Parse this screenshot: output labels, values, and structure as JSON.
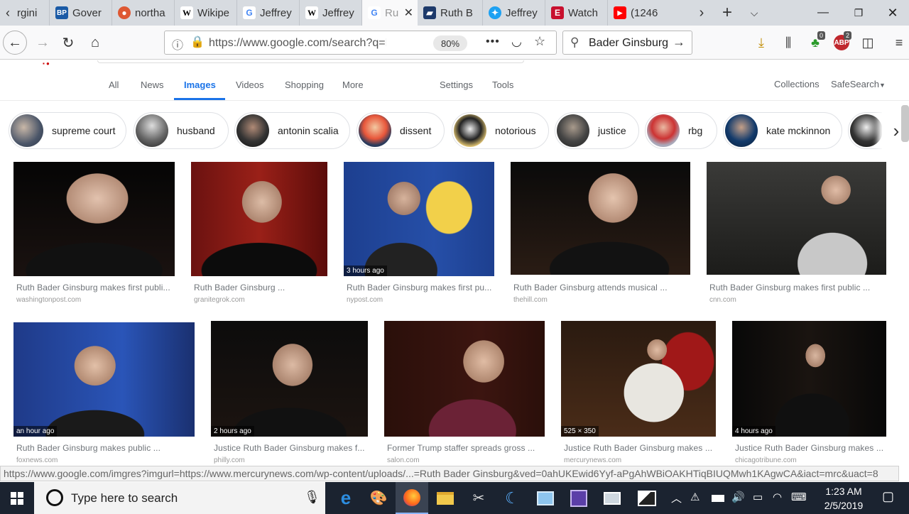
{
  "browser": {
    "tabs": [
      {
        "title": "rgini",
        "icon": "browser-back-icon"
      },
      {
        "title": "Gover",
        "icon": "bp-icon",
        "favicon_text": "BP",
        "color": "#1a5aa6"
      },
      {
        "title": "northa",
        "icon": "duckduckgo-icon",
        "color": "#de5833"
      },
      {
        "title": "Wikipe",
        "icon": "wikipedia-icon",
        "favicon_text": "W"
      },
      {
        "title": "Jeffrey",
        "icon": "google-icon",
        "favicon_text": "G"
      },
      {
        "title": "Jeffrey",
        "icon": "wikipedia-icon",
        "favicon_text": "W"
      },
      {
        "title": "Ru",
        "icon": "google-icon",
        "favicon_text": "G",
        "active": true
      },
      {
        "title": "Ruth B",
        "icon": "news-icon"
      },
      {
        "title": "Jeffrey",
        "icon": "twitter-icon"
      },
      {
        "title": "Watch",
        "icon": "flag-icon",
        "favicon_text": "E"
      },
      {
        "title": "(1246",
        "icon": "youtube-icon"
      }
    ],
    "url": "https://www.google.com/search?q=Ru",
    "zoom": "80%",
    "search_query": "Bader Ginsburg",
    "toolbar_badges": {
      "green": "0",
      "abp": "2"
    },
    "status_url": "https://www.google.com/imgres?imgurl=https://www.mercurynews.com/wp-content/uploads/...=Ruth Bader Ginsburg&ved=0ahUKEwid6Yyf-aPgAhWBiOAKHTiqBIUQMwh1KAgwCA&iact=mrc&uact=8"
  },
  "google": {
    "nav": [
      "All",
      "News",
      "Images",
      "Videos",
      "Shopping",
      "More"
    ],
    "active_nav": "Images",
    "tools": [
      "Settings",
      "Tools"
    ],
    "right": [
      "Collections",
      "SafeSearch"
    ],
    "chips": [
      "supreme court",
      "husband",
      "antonin scalia",
      "dissent",
      "notorious",
      "justice",
      "rbg",
      "kate mckinnon"
    ]
  },
  "results": [
    {
      "title": "Ruth Bader Ginsburg makes first publi...",
      "source": "washingtonpost.com",
      "tag": ""
    },
    {
      "title": "Ruth Bader Ginsburg ...",
      "source": "granitegrok.com",
      "tag": ""
    },
    {
      "title": "Ruth Bader Ginsburg makes first pu...",
      "source": "nypost.com",
      "tag": "3 hours ago"
    },
    {
      "title": "Ruth Bader Ginsburg attends musical ...",
      "source": "thehill.com",
      "tag": ""
    },
    {
      "title": "Ruth Bader Ginsburg makes first public ...",
      "source": "cnn.com",
      "tag": ""
    },
    {
      "title": "Ruth Bader Ginsburg makes public ...",
      "source": "foxnews.com",
      "tag": "an hour ago"
    },
    {
      "title": "Justice Ruth Bader Ginsburg makes f...",
      "source": "philly.com",
      "tag": "2 hours ago"
    },
    {
      "title": "Former Trump staffer spreads gross ...",
      "source": "salon.com",
      "tag": ""
    },
    {
      "title": "Justice Ruth Bader Ginsburg makes ...",
      "source": "mercurynews.com",
      "tag": "525 × 350"
    },
    {
      "title": "Justice Ruth Bader Ginsburg makes ...",
      "source": "chicagotribune.com",
      "tag": "4 hours ago"
    }
  ],
  "taskbar": {
    "search_placeholder": "Type here to search",
    "time": "1:23 AM",
    "date": "2/5/2019"
  }
}
